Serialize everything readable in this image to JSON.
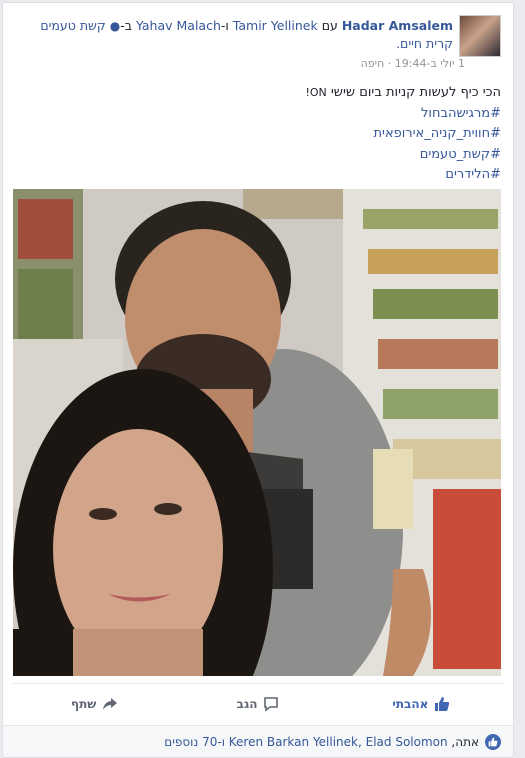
{
  "post": {
    "author": "Hadar Amsalem",
    "with_word": "עם",
    "tagged_1": "Tamir Yellinek",
    "and_word": "ו-",
    "tagged_2": "Yahav Malach",
    "at_word": "ב-",
    "place": "קשת טעמים",
    "place_city": "קרית חיים.",
    "date": "1 יולי ב-19:44",
    "sep": "·",
    "city": "חיפה",
    "text_line": "הכי כיף לעשות קניות ביום שישי",
    "emoji": "ON!",
    "hashtags": [
      "#מרגישהבחול",
      "#חווית_קניה_אירופאית",
      "#קשת_טעמים",
      "#הלידרים"
    ]
  },
  "actions": {
    "like": "אהבתי",
    "comment": "הגב",
    "share": "שתף"
  },
  "likes": {
    "prefix": "אתה, ",
    "names": "Keren Barkan Yellinek, Elad Solomon",
    "suffix": " ו-70 נוספים"
  },
  "colors": {
    "link": "#365899",
    "like_active": "#4267b2",
    "meta": "#90949c"
  }
}
